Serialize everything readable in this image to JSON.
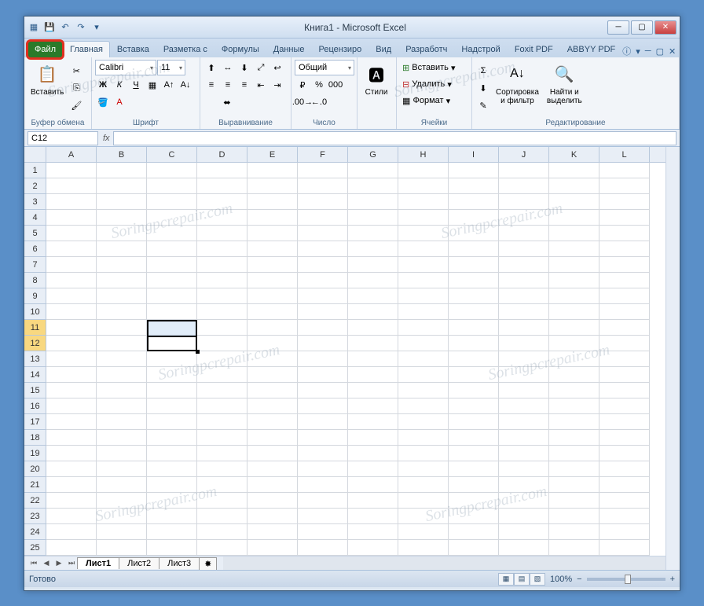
{
  "title": "Книга1 - Microsoft Excel",
  "qat": {
    "save": "💾",
    "undo": "↶",
    "redo": "↷"
  },
  "tabs": {
    "file": "Файл",
    "items": [
      "Главная",
      "Вставка",
      "Разметка с",
      "Формулы",
      "Данные",
      "Рецензиро",
      "Вид",
      "Разработч",
      "Надстрой",
      "Foxit PDF",
      "ABBYY PDF"
    ]
  },
  "ribbon": {
    "clipboard": {
      "paste": "Вставить",
      "label": "Буфер обмена"
    },
    "font": {
      "name": "Calibri",
      "size": "11",
      "label": "Шрифт",
      "bold": "Ж",
      "italic": "К",
      "underline": "Ч"
    },
    "align": {
      "label": "Выравнивание"
    },
    "number": {
      "format": "Общий",
      "label": "Число"
    },
    "styles": {
      "btn": "Стили",
      "label": ""
    },
    "cells": {
      "insert": "Вставить",
      "delete": "Удалить",
      "format": "Формат",
      "label": "Ячейки"
    },
    "editing": {
      "sort": "Сортировка\nи фильтр",
      "find": "Найти и\nвыделить",
      "label": "Редактирование"
    }
  },
  "namebox": "C12",
  "fx": "fx",
  "columns": [
    "A",
    "B",
    "C",
    "D",
    "E",
    "F",
    "G",
    "H",
    "I",
    "J",
    "K",
    "L"
  ],
  "rows": [
    "1",
    "2",
    "3",
    "4",
    "5",
    "6",
    "7",
    "8",
    "9",
    "10",
    "11",
    "12",
    "13",
    "14",
    "15",
    "16",
    "17",
    "18",
    "19",
    "20",
    "21",
    "22",
    "23",
    "24",
    "25"
  ],
  "selected_rows": [
    10,
    11
  ],
  "sheets": [
    "Лист1",
    "Лист2",
    "Лист3"
  ],
  "status": "Готово",
  "zoom": "100%",
  "watermark": "Soringpcrepair.com"
}
